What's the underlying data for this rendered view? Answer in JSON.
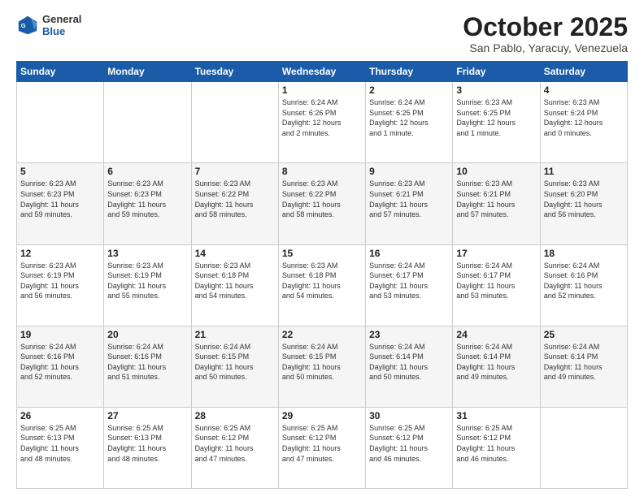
{
  "logo": {
    "general": "General",
    "blue": "Blue"
  },
  "header": {
    "title": "October 2025",
    "subtitle": "San Pablo, Yaracuy, Venezuela"
  },
  "weekdays": [
    "Sunday",
    "Monday",
    "Tuesday",
    "Wednesday",
    "Thursday",
    "Friday",
    "Saturday"
  ],
  "weeks": [
    [
      {
        "day": "",
        "info": ""
      },
      {
        "day": "",
        "info": ""
      },
      {
        "day": "",
        "info": ""
      },
      {
        "day": "1",
        "info": "Sunrise: 6:24 AM\nSunset: 6:26 PM\nDaylight: 12 hours\nand 2 minutes."
      },
      {
        "day": "2",
        "info": "Sunrise: 6:24 AM\nSunset: 6:25 PM\nDaylight: 12 hours\nand 1 minute."
      },
      {
        "day": "3",
        "info": "Sunrise: 6:23 AM\nSunset: 6:25 PM\nDaylight: 12 hours\nand 1 minute."
      },
      {
        "day": "4",
        "info": "Sunrise: 6:23 AM\nSunset: 6:24 PM\nDaylight: 12 hours\nand 0 minutes."
      }
    ],
    [
      {
        "day": "5",
        "info": "Sunrise: 6:23 AM\nSunset: 6:23 PM\nDaylight: 11 hours\nand 59 minutes."
      },
      {
        "day": "6",
        "info": "Sunrise: 6:23 AM\nSunset: 6:23 PM\nDaylight: 11 hours\nand 59 minutes."
      },
      {
        "day": "7",
        "info": "Sunrise: 6:23 AM\nSunset: 6:22 PM\nDaylight: 11 hours\nand 58 minutes."
      },
      {
        "day": "8",
        "info": "Sunrise: 6:23 AM\nSunset: 6:22 PM\nDaylight: 11 hours\nand 58 minutes."
      },
      {
        "day": "9",
        "info": "Sunrise: 6:23 AM\nSunset: 6:21 PM\nDaylight: 11 hours\nand 57 minutes."
      },
      {
        "day": "10",
        "info": "Sunrise: 6:23 AM\nSunset: 6:21 PM\nDaylight: 11 hours\nand 57 minutes."
      },
      {
        "day": "11",
        "info": "Sunrise: 6:23 AM\nSunset: 6:20 PM\nDaylight: 11 hours\nand 56 minutes."
      }
    ],
    [
      {
        "day": "12",
        "info": "Sunrise: 6:23 AM\nSunset: 6:19 PM\nDaylight: 11 hours\nand 56 minutes."
      },
      {
        "day": "13",
        "info": "Sunrise: 6:23 AM\nSunset: 6:19 PM\nDaylight: 11 hours\nand 55 minutes."
      },
      {
        "day": "14",
        "info": "Sunrise: 6:23 AM\nSunset: 6:18 PM\nDaylight: 11 hours\nand 54 minutes."
      },
      {
        "day": "15",
        "info": "Sunrise: 6:23 AM\nSunset: 6:18 PM\nDaylight: 11 hours\nand 54 minutes."
      },
      {
        "day": "16",
        "info": "Sunrise: 6:24 AM\nSunset: 6:17 PM\nDaylight: 11 hours\nand 53 minutes."
      },
      {
        "day": "17",
        "info": "Sunrise: 6:24 AM\nSunset: 6:17 PM\nDaylight: 11 hours\nand 53 minutes."
      },
      {
        "day": "18",
        "info": "Sunrise: 6:24 AM\nSunset: 6:16 PM\nDaylight: 11 hours\nand 52 minutes."
      }
    ],
    [
      {
        "day": "19",
        "info": "Sunrise: 6:24 AM\nSunset: 6:16 PM\nDaylight: 11 hours\nand 52 minutes."
      },
      {
        "day": "20",
        "info": "Sunrise: 6:24 AM\nSunset: 6:16 PM\nDaylight: 11 hours\nand 51 minutes."
      },
      {
        "day": "21",
        "info": "Sunrise: 6:24 AM\nSunset: 6:15 PM\nDaylight: 11 hours\nand 50 minutes."
      },
      {
        "day": "22",
        "info": "Sunrise: 6:24 AM\nSunset: 6:15 PM\nDaylight: 11 hours\nand 50 minutes."
      },
      {
        "day": "23",
        "info": "Sunrise: 6:24 AM\nSunset: 6:14 PM\nDaylight: 11 hours\nand 50 minutes."
      },
      {
        "day": "24",
        "info": "Sunrise: 6:24 AM\nSunset: 6:14 PM\nDaylight: 11 hours\nand 49 minutes."
      },
      {
        "day": "25",
        "info": "Sunrise: 6:24 AM\nSunset: 6:14 PM\nDaylight: 11 hours\nand 49 minutes."
      }
    ],
    [
      {
        "day": "26",
        "info": "Sunrise: 6:25 AM\nSunset: 6:13 PM\nDaylight: 11 hours\nand 48 minutes."
      },
      {
        "day": "27",
        "info": "Sunrise: 6:25 AM\nSunset: 6:13 PM\nDaylight: 11 hours\nand 48 minutes."
      },
      {
        "day": "28",
        "info": "Sunrise: 6:25 AM\nSunset: 6:12 PM\nDaylight: 11 hours\nand 47 minutes."
      },
      {
        "day": "29",
        "info": "Sunrise: 6:25 AM\nSunset: 6:12 PM\nDaylight: 11 hours\nand 47 minutes."
      },
      {
        "day": "30",
        "info": "Sunrise: 6:25 AM\nSunset: 6:12 PM\nDaylight: 11 hours\nand 46 minutes."
      },
      {
        "day": "31",
        "info": "Sunrise: 6:25 AM\nSunset: 6:12 PM\nDaylight: 11 hours\nand 46 minutes."
      },
      {
        "day": "",
        "info": ""
      }
    ]
  ]
}
